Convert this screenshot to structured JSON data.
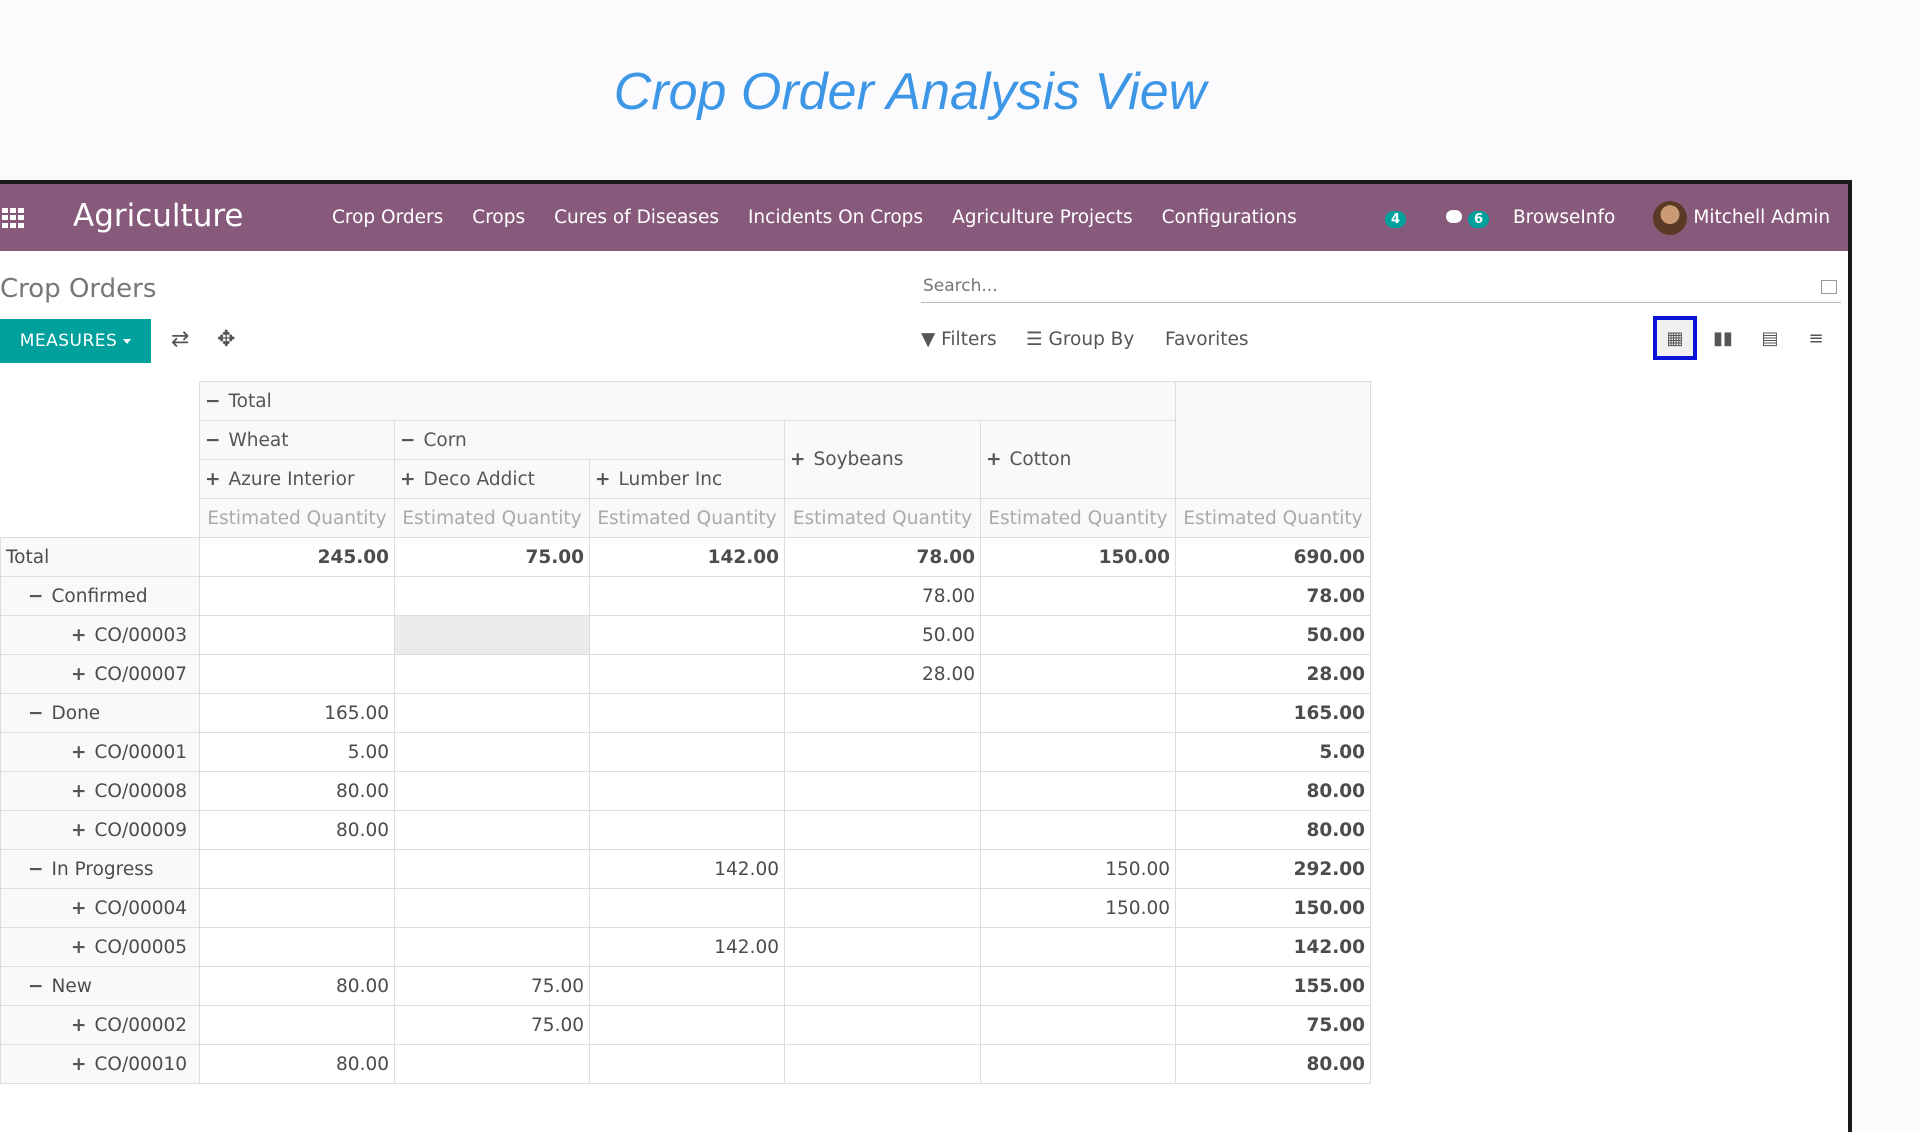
{
  "caption": "Crop Order Analysis View",
  "navbar": {
    "app_title": "Agriculture",
    "menu": [
      "Crop Orders",
      "Crops",
      "Cures of Diseases",
      "Incidents On Crops",
      "Agriculture Projects",
      "Configurations"
    ],
    "activity_count": "4",
    "message_count": "6",
    "company": "BrowseInfo",
    "user": "Mitchell Admin"
  },
  "control_panel": {
    "title": "Crop Orders",
    "search_placeholder": "Search...",
    "measures_label": "MEASURES",
    "filters_label": "Filters",
    "group_by_label": "Group By",
    "favorites_label": "Favorites",
    "views": [
      "pivot-icon",
      "graph-icon",
      "calendar-icon",
      "list-icon"
    ],
    "active_view": "pivot"
  },
  "pivot": {
    "col_total": "Total",
    "col_groups": [
      {
        "name": "Wheat",
        "sub": [
          "Azure Interior"
        ]
      },
      {
        "name": "Corn",
        "sub": [
          "Deco Addict",
          "Lumber Inc"
        ]
      },
      {
        "name": "Soybeans",
        "sub": []
      },
      {
        "name": "Cotton",
        "sub": []
      }
    ],
    "measure": "Estimated Quantity",
    "rows": [
      {
        "label": "Total",
        "level": 0,
        "sign": "",
        "values": [
          "245.00",
          "75.00",
          "142.00",
          "78.00",
          "150.00",
          "690.00"
        ],
        "bold": true
      },
      {
        "label": "Confirmed",
        "level": 1,
        "sign": "−",
        "values": [
          "",
          "",
          "",
          "78.00",
          "",
          "78.00"
        ]
      },
      {
        "label": "CO/00003",
        "level": 2,
        "sign": "+",
        "values": [
          "",
          "",
          "",
          "50.00",
          "",
          "50.00"
        ]
      },
      {
        "label": "CO/00007",
        "level": 2,
        "sign": "+",
        "values": [
          "",
          "",
          "",
          "28.00",
          "",
          "28.00"
        ]
      },
      {
        "label": "Done",
        "level": 1,
        "sign": "−",
        "values": [
          "165.00",
          "",
          "",
          "",
          "",
          "165.00"
        ]
      },
      {
        "label": "CO/00001",
        "level": 2,
        "sign": "+",
        "values": [
          "5.00",
          "",
          "",
          "",
          "",
          "5.00"
        ]
      },
      {
        "label": "CO/00008",
        "level": 2,
        "sign": "+",
        "values": [
          "80.00",
          "",
          "",
          "",
          "",
          "80.00"
        ]
      },
      {
        "label": "CO/00009",
        "level": 2,
        "sign": "+",
        "values": [
          "80.00",
          "",
          "",
          "",
          "",
          "80.00"
        ]
      },
      {
        "label": "In Progress",
        "level": 1,
        "sign": "−",
        "values": [
          "",
          "",
          "142.00",
          "",
          "150.00",
          "292.00"
        ]
      },
      {
        "label": "CO/00004",
        "level": 2,
        "sign": "+",
        "values": [
          "",
          "",
          "",
          "",
          "150.00",
          "150.00"
        ]
      },
      {
        "label": "CO/00005",
        "level": 2,
        "sign": "+",
        "values": [
          "",
          "",
          "142.00",
          "",
          "",
          "142.00"
        ]
      },
      {
        "label": "New",
        "level": 1,
        "sign": "−",
        "values": [
          "80.00",
          "75.00",
          "",
          "",
          "",
          "155.00"
        ]
      },
      {
        "label": "CO/00002",
        "level": 2,
        "sign": "+",
        "values": [
          "",
          "75.00",
          "",
          "",
          "",
          "75.00"
        ]
      },
      {
        "label": "CO/00010",
        "level": 2,
        "sign": "+",
        "values": [
          "80.00",
          "",
          "",
          "",
          "",
          "80.00"
        ]
      }
    ]
  }
}
